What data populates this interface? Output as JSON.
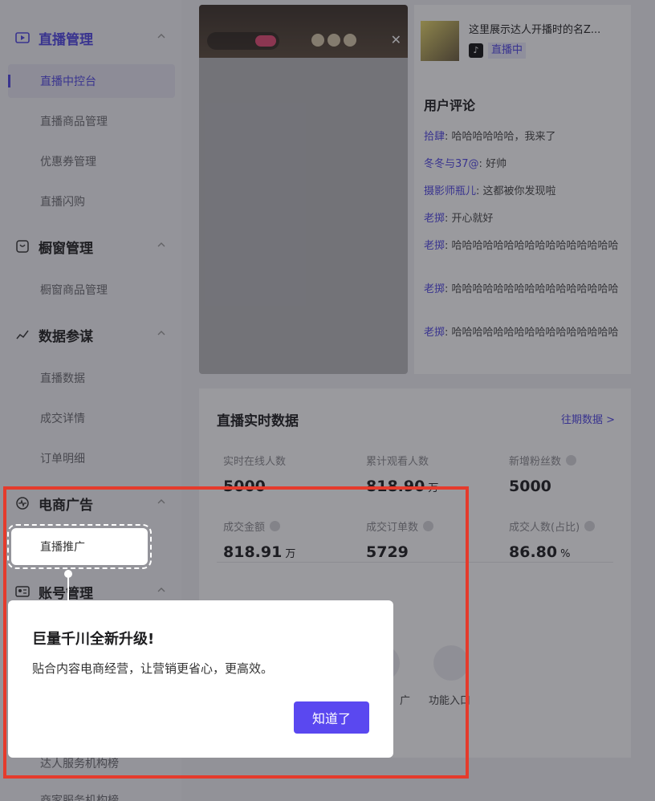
{
  "sidebar": {
    "groups": [
      {
        "label": "直播管理",
        "icon": "live-icon"
      },
      {
        "label": "橱窗管理",
        "icon": "window-icon"
      },
      {
        "label": "数据参谋",
        "icon": "chart-icon"
      },
      {
        "label": "电商广告",
        "icon": "ad-icon"
      },
      {
        "label": "账号管理",
        "icon": "account-icon"
      }
    ],
    "items": [
      {
        "label": "直播中控台"
      },
      {
        "label": "直播商品管理"
      },
      {
        "label": "优惠券管理"
      },
      {
        "label": "直播闪购"
      },
      {
        "label": "橱窗商品管理"
      },
      {
        "label": "直播数据"
      },
      {
        "label": "成交详情"
      },
      {
        "label": "订单明细"
      },
      {
        "label": "直播推广"
      },
      {
        "label": "达人服务机构榜"
      },
      {
        "label": "商家服务机构榜"
      }
    ]
  },
  "stream": {
    "title": "这里展示达人开播时的名Z...",
    "status": "直播中",
    "tiktok_glyph": "♪"
  },
  "comments": {
    "title": "用户评论",
    "list": [
      {
        "user": "拾肆",
        "text": "哈哈哈哈哈哈，我来了"
      },
      {
        "user": "冬冬与37@",
        "text": "好帅"
      },
      {
        "user": "摄影师瓶儿",
        "text": "这都被你发现啦"
      },
      {
        "user": "老掷",
        "text": "开心就好"
      },
      {
        "user": "老掷",
        "text": "哈哈哈哈哈哈哈哈哈哈哈哈哈哈哈哈"
      },
      {
        "user": "老掷",
        "text": "哈哈哈哈哈哈哈哈哈哈哈哈哈哈哈哈"
      },
      {
        "user": "老掷",
        "text": "哈哈哈哈哈哈哈哈哈哈哈哈哈哈哈哈"
      }
    ]
  },
  "realtime": {
    "title": "直播实时数据",
    "history_link": "往期数据 >",
    "metrics": [
      {
        "label": "实时在线人数",
        "value": "5000",
        "unit": ""
      },
      {
        "label": "累计观看人数",
        "value": "818.90",
        "unit": "万"
      },
      {
        "label": "新增粉丝数",
        "value": "5000",
        "unit": ""
      },
      {
        "label": "成交金额",
        "value": "818.91",
        "unit": "万"
      },
      {
        "label": "成交订单数",
        "value": "5729",
        "unit": ""
      },
      {
        "label": "成交人数(占比)",
        "value": "86.80",
        "unit": "%"
      }
    ],
    "feature_labels": [
      "广",
      "功能入口"
    ]
  },
  "dialog": {
    "title": "巨量千川全新升级!",
    "body": "贴合内容电商经营，让营销更省心，更高效。",
    "button": "知道了"
  },
  "colors": {
    "accent": "#4f45e3",
    "highlight": "#e53b2c",
    "button": "#5a48f0"
  }
}
